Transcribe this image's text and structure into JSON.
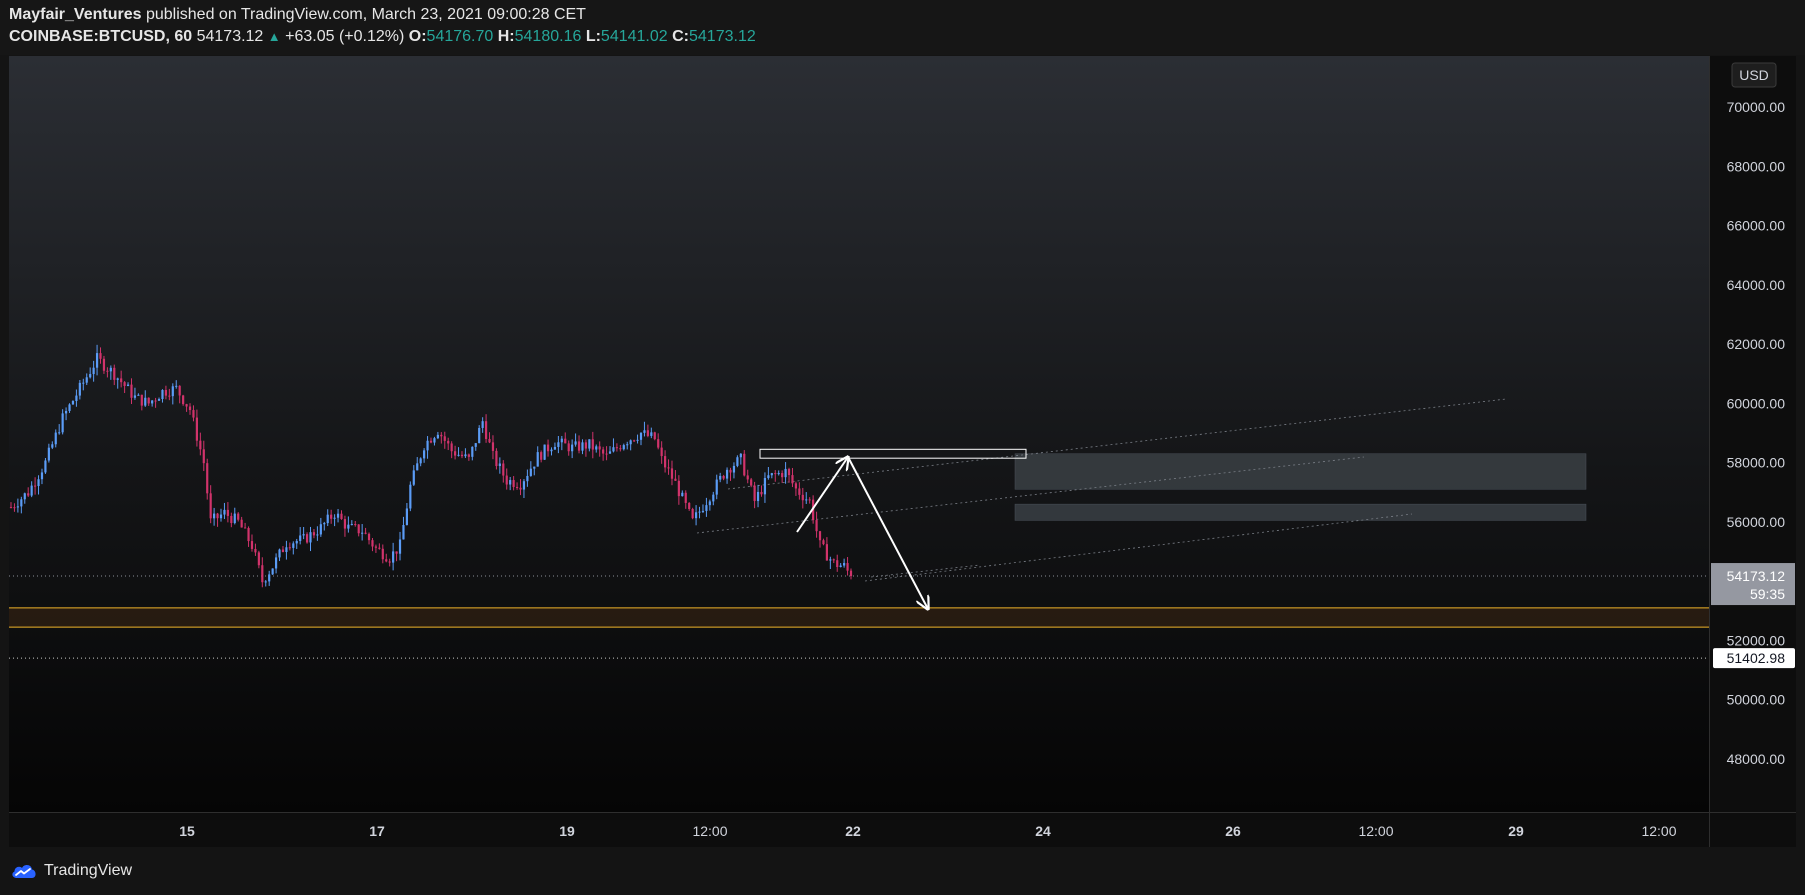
{
  "header": {
    "author": "Mayfair_Ventures",
    "published": "published on TradingView.com, March 23, 2021 09:00:28 CET",
    "symbol": "COINBASE:BTCUSD, 60",
    "last": "54173.12",
    "change": "+63.05 (+0.12%)",
    "o_label": "O:",
    "o_value": "54176.70",
    "h_label": "H:",
    "h_value": "54180.16",
    "l_label": "L:",
    "l_value": "54141.02",
    "c_label": "C:",
    "c_value": "54173.12"
  },
  "branding": {
    "logo_text": "TradingView",
    "logo_icon": "tradingview-cloud-icon"
  },
  "colors": {
    "bull": "#5b9cf6",
    "bear": "#d1336b",
    "axis_text": "#d1d4dc",
    "support_line": "#f0b429",
    "zone_fill": "#3a3f44",
    "current_price_label": "#9598a1"
  },
  "chart_data": {
    "type": "candlestick",
    "symbol": "COINBASE:BTCUSD",
    "timeframe": "60",
    "currency": "USD",
    "ylim": [
      46000,
      71000
    ],
    "y_ticks": [
      48000,
      50000,
      52000,
      54000,
      56000,
      58000,
      60000,
      62000,
      64000,
      66000,
      68000,
      70000
    ],
    "y_tick_labels": [
      "48000.00",
      "50000.00",
      "52000.00",
      "54000.00",
      "56000.00",
      "58000.00",
      "60000.00",
      "62000.00",
      "64000.00",
      "66000.00",
      "68000.00",
      "70000.00"
    ],
    "x_tick_labels": [
      "15",
      "17",
      "19",
      "12:00",
      "22",
      "24",
      "26",
      "12:00",
      "29",
      "12:00"
    ],
    "current_price": 54173.12,
    "current_price_label": "54173.12",
    "countdown_label": "59:35",
    "alert_price": 51402.98,
    "alert_price_label": "51402.98",
    "support_zone": [
      52450,
      53100
    ],
    "supply_zones": [
      [
        57100,
        58300
      ],
      [
        56050,
        56600
      ]
    ],
    "range_box": [
      58150,
      58450
    ],
    "ohlc_last": {
      "open": 54176.7,
      "high": 54180.16,
      "low": 54141.02,
      "close": 54173.12
    },
    "path": [
      [
        0,
        56500
      ],
      [
        5,
        57000
      ],
      [
        10,
        58000
      ],
      [
        15,
        59500
      ],
      [
        20,
        60500
      ],
      [
        25,
        61500
      ],
      [
        30,
        61000
      ],
      [
        36,
        60200
      ],
      [
        40,
        60000
      ],
      [
        44,
        60400
      ],
      [
        48,
        60500
      ],
      [
        52,
        59800
      ],
      [
        56,
        58000
      ],
      [
        58,
        56000
      ],
      [
        62,
        56300
      ],
      [
        66,
        56000
      ],
      [
        70,
        55200
      ],
      [
        73,
        54000
      ],
      [
        76,
        54500
      ],
      [
        80,
        55300
      ],
      [
        85,
        55400
      ],
      [
        90,
        55800
      ],
      [
        94,
        56300
      ],
      [
        98,
        55800
      ],
      [
        102,
        55700
      ],
      [
        106,
        55100
      ],
      [
        110,
        54800
      ],
      [
        113,
        55200
      ],
      [
        116,
        57200
      ],
      [
        120,
        58600
      ],
      [
        124,
        59100
      ],
      [
        128,
        58400
      ],
      [
        133,
        58100
      ],
      [
        137,
        59400
      ],
      [
        140,
        58200
      ],
      [
        144,
        57400
      ],
      [
        148,
        57300
      ],
      [
        153,
        58200
      ],
      [
        158,
        58700
      ],
      [
        163,
        58500
      ],
      [
        168,
        58600
      ],
      [
        173,
        58200
      ],
      [
        178,
        58700
      ],
      [
        183,
        59000
      ],
      [
        187,
        58800
      ],
      [
        189,
        58100
      ],
      [
        193,
        57300
      ],
      [
        198,
        56000
      ],
      [
        203,
        56900
      ],
      [
        208,
        57800
      ],
      [
        212,
        58100
      ],
      [
        216,
        56700
      ],
      [
        220,
        57500
      ],
      [
        225,
        57700
      ],
      [
        228,
        57100
      ],
      [
        232,
        56700
      ],
      [
        235,
        55200
      ],
      [
        239,
        54600
      ],
      [
        242,
        54500
      ],
      [
        244,
        54173
      ]
    ]
  }
}
